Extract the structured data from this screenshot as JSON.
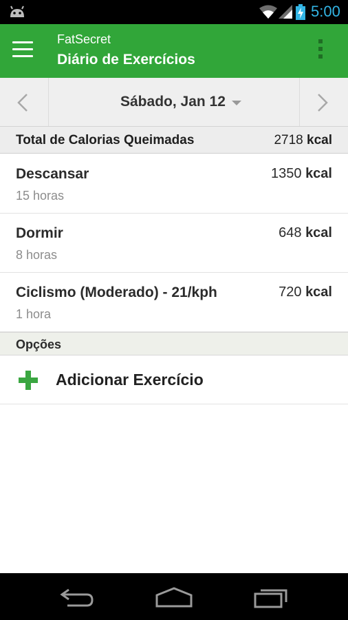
{
  "status_bar": {
    "time": "5:00",
    "icons": [
      "android-icon",
      "wifi-icon",
      "signal-icon",
      "battery-icon"
    ],
    "accent_color": "#33b5e5"
  },
  "action_bar": {
    "app_name": "FatSecret",
    "title": "Diário de Exercícios",
    "background_color": "#31a639",
    "icons": [
      "menu-icon",
      "overflow-menu-icon"
    ]
  },
  "date_nav": {
    "date": "Sábado, Jan 12",
    "icons": [
      "chevron-left-icon",
      "caret-down-icon",
      "chevron-right-icon"
    ]
  },
  "total": {
    "label": "Total de Calorias Queimadas",
    "value": "2718",
    "unit": "kcal"
  },
  "entries": [
    {
      "name": "Descansar",
      "duration": "15 horas",
      "value": "1350",
      "unit": "kcal"
    },
    {
      "name": "Dormir",
      "duration": "8 horas",
      "value": "648",
      "unit": "kcal"
    },
    {
      "name": "Ciclismo (Moderado) - 21/kph",
      "duration": "1 hora",
      "value": "720",
      "unit": "kcal"
    }
  ],
  "options": {
    "label": "Opções",
    "add_label": "Adicionar Exercício",
    "add_icon": "plus-icon",
    "add_icon_color": "#3aa641"
  },
  "system_nav": {
    "icons": [
      "back-icon",
      "home-icon",
      "recents-icon"
    ]
  }
}
